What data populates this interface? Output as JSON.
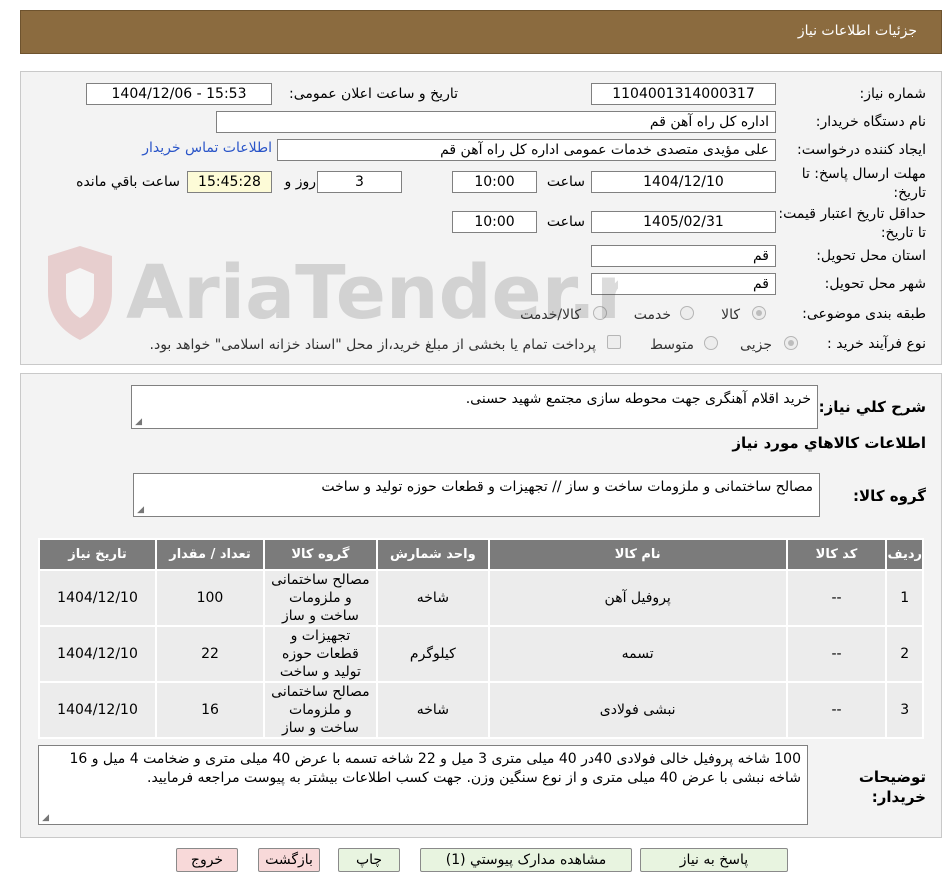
{
  "header": {
    "title": "جزئیات اطلاعات نیاز"
  },
  "form": {
    "need_number_label": "شماره نیاز:",
    "need_number": "1104001314000317",
    "announce_label": "تاریخ و ساعت اعلان عمومی:",
    "announce_value": "1404/12/06 - 15:53",
    "buyer_org_label": "نام دستگاه خریدار:",
    "buyer_org": "اداره کل  راه آهن قم",
    "creator_label": "ایجاد کننده درخواست:",
    "creator": "علی مؤیدی متصدی خدمات عمومی اداره کل  راه آهن قم",
    "contact_link": "اطلاعات تماس خریدار",
    "reply_deadline_label": "مهلت ارسال پاسخ: تا تاریخ:",
    "reply_date": "1404/12/10",
    "time_label": "ساعت",
    "reply_time": "10:00",
    "days_value": "3",
    "days_label": "روز و",
    "remaining_time": "15:45:28",
    "remaining_label": "ساعت باقي مانده",
    "price_validity_label": "حداقل تاریخ اعتبار قیمت: تا تاریخ:",
    "price_date": "1405/02/31",
    "price_time": "10:00",
    "province_label": "استان محل تحویل:",
    "province": "قم",
    "city_label": "شهر محل تحویل:",
    "city": "قم",
    "category_label": "طبقه بندی موضوعی:",
    "category_options": [
      "کالا",
      "خدمت",
      "کالا/خدمت"
    ],
    "purchase_type_label": "نوع فرآیند خرید :",
    "purchase_options": [
      "جزیی",
      "متوسط"
    ],
    "payment_note": "پرداخت تمام یا بخشی از مبلغ خرید،از محل \"اسناد خزانه اسلامی\" خواهد بود."
  },
  "details": {
    "summary_label": "شرح کلي نياز:",
    "summary": "خرید اقلام آهنگری جهت محوطه سازی مجتمع شهید حسنی.",
    "goods_info_title": "اطلاعات کالاهاي مورد نياز",
    "goods_group_label": "گروه کالا:",
    "goods_group": "مصالح ساختمانی و ملزومات ساخت و ساز // تجهیزات و قطعات حوزه تولید و ساخت"
  },
  "table": {
    "headers": [
      "رديف",
      "کد کالا",
      "نام کالا",
      "واحد شمارش",
      "گروه کالا",
      "تعداد / مقدار",
      "تاريخ نياز"
    ],
    "rows": [
      [
        "1",
        "--",
        "پروفیل آهن",
        "شاخه",
        "مصالح ساختمانی و ملزومات ساخت و ساز",
        "100",
        "1404/12/10"
      ],
      [
        "2",
        "--",
        "تسمه",
        "کیلوگرم",
        "تجهیزات و قطعات حوزه تولید و ساخت",
        "22",
        "1404/12/10"
      ],
      [
        "3",
        "--",
        "نبشی فولادی",
        "شاخه",
        "مصالح ساختمانی و ملزومات ساخت و ساز",
        "16",
        "1404/12/10"
      ]
    ]
  },
  "buyer_notes": {
    "label": "توضیحات خریدار:",
    "text": "100 شاخه پروفیل خالی فولادی 40در 40 میلی متری 3 میل و 22 شاخه تسمه با عرض 40 میلی متری و ضخامت 4 میل و 16 شاخه نبشی با عرض 40 میلی متری و از نوع سنگین وزن. جهت کسب اطلاعات بیشتر به پیوست مراجعه فرمایید."
  },
  "buttons": {
    "reply": "پاسخ به نياز",
    "attachments": "مشاهده مدارک پيوستي (1)",
    "print": "چاپ",
    "back": "بازگشت",
    "exit": "خروج"
  },
  "watermark": {
    "text": "AriaTender.neT"
  },
  "colors": {
    "header": "#8b6b3f",
    "table_header": "#7b7b7b",
    "link": "#2a55c8",
    "button_green": "#e8f4e0",
    "button_pink": "#f8d9d9"
  }
}
